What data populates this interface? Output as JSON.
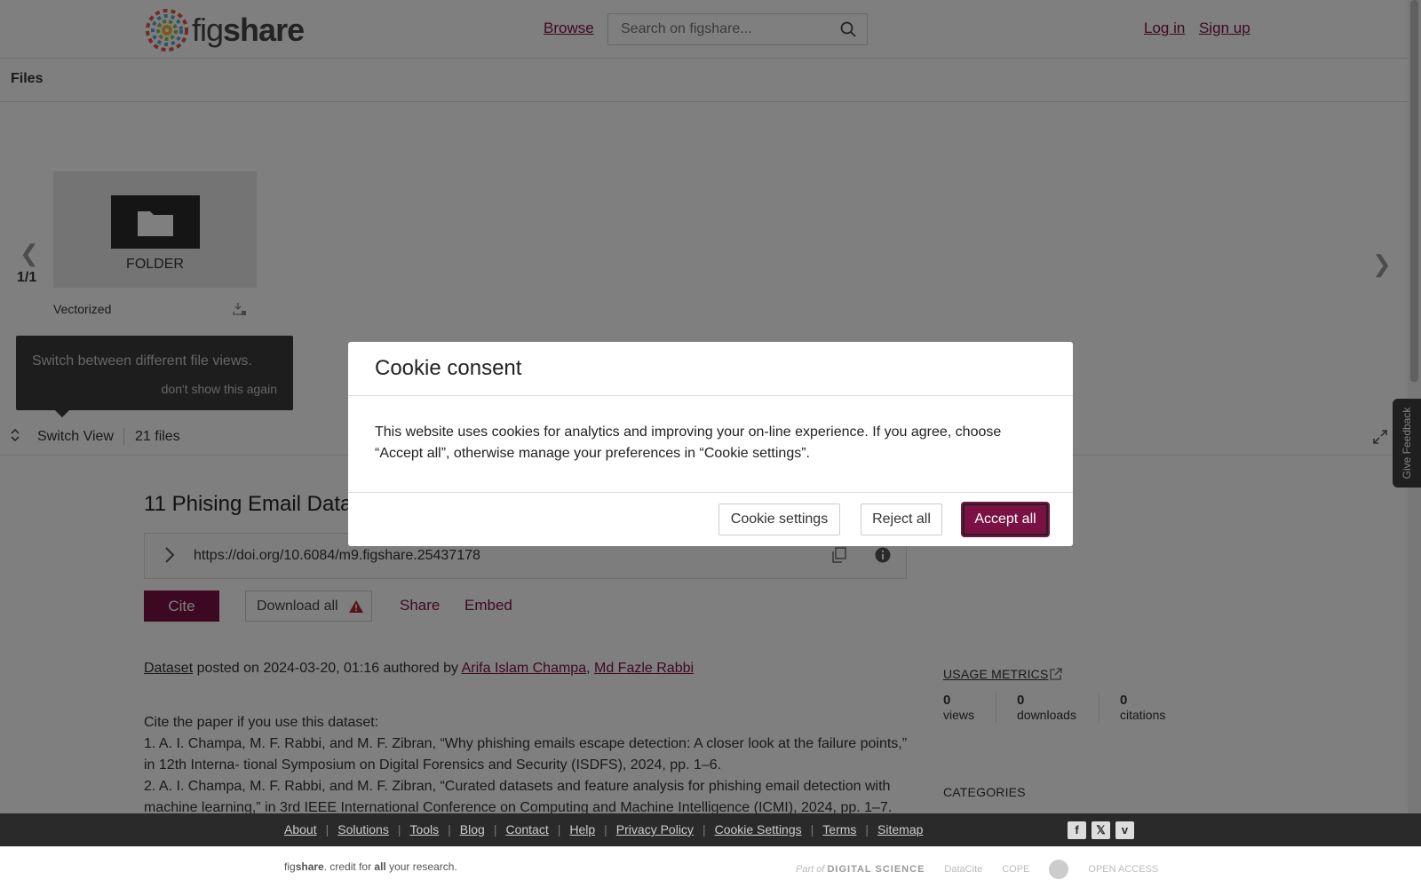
{
  "header": {
    "logo_text_a": "fig",
    "logo_text_b": "share",
    "browse": "Browse",
    "search_placeholder": "Search on figshare...",
    "login": "Log in",
    "signup": "Sign up"
  },
  "files_panel": {
    "heading": "Files",
    "counter": "1/1",
    "tile_type": "FOLDER",
    "tile_name": "Vectorized",
    "tooltip_text": "Switch between different file views.",
    "tooltip_dismiss": "don't show this again",
    "switch_view": "Switch View",
    "file_count": "21 files"
  },
  "item": {
    "title": "11 Phising Email Data",
    "doi": "https://doi.org/10.6084/m9.figshare.25437178",
    "cite": "Cite",
    "download_all": "Download all",
    "share": "Share",
    "embed": "Embed",
    "type_link": "Dataset",
    "posted_text": " posted on 2024-03-20, 01:16 authored by ",
    "author1": "Arifa Islam Champa",
    "author_sep": ", ",
    "author2": "Md Fazle Rabbi",
    "desc_intro": "Cite the paper if you use this dataset:",
    "desc_ref1": "1. A. I. Champa, M. F. Rabbi, and M. F. Zibran, “Why phishing emails escape detection: A closer look at the failure points,” in 12th Interna- tional Symposium on Digital Forensics and Security (ISDFS), 2024, pp. 1–6.",
    "desc_ref2": "2. A. I. Champa, M. F. Rabbi, and M. F. Zibran, “Curated datasets and feature analysis for phishing email detection with machine learning,” in 3rd IEEE International Conference on Computing and Machine Intelligence (ICMI), 2024, pp. 1–7."
  },
  "sidebar": {
    "usage_metrics": "USAGE METRICS",
    "views_value": "0",
    "views_label": "views",
    "downloads_value": "0",
    "downloads_label": "downloads",
    "citations_value": "0",
    "citations_label": "citations",
    "categories": "CATEGORIES"
  },
  "feedback": "Give Feedback",
  "cookie_modal": {
    "title": "Cookie consent",
    "body": "This website uses cookies for analytics and improving your on-line experience. If you agree, choose “Accept all”, otherwise manage your preferences in “Cookie settings”.",
    "settings_button": "Cookie settings",
    "reject_button": "Reject all",
    "accept_button": "Accept all"
  },
  "footer": {
    "links": [
      "About",
      "Solutions",
      "Tools",
      "Blog",
      "Contact",
      "Help",
      "Privacy Policy",
      "Cookie Settings",
      "Terms",
      "Sitemap"
    ],
    "tagline_a": "fig",
    "tagline_b": "share",
    "tagline_c": ". credit for ",
    "tagline_d": "all",
    "tagline_e": " your research.",
    "partner_prefix": "Part of",
    "partner_name": "DIGITAL SCIENCE",
    "partner_datacite": "DataCite",
    "partner_cope": "COPE",
    "partner_oa": "OPEN ACCESS"
  },
  "colors": {
    "brand": "#7b1042",
    "footer_bg": "#2a2a2a"
  }
}
